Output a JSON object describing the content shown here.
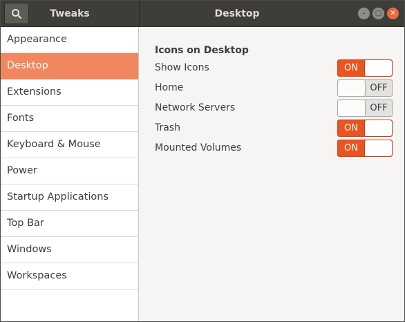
{
  "titlebar": {
    "search_icon": "search-icon",
    "app_title": "Tweaks",
    "page_title": "Desktop",
    "controls": {
      "minimize_glyph": "–",
      "maximize_glyph": "□",
      "close_glyph": "✕"
    }
  },
  "sidebar": {
    "items": [
      {
        "label": "Appearance",
        "active": false
      },
      {
        "label": "Desktop",
        "active": true
      },
      {
        "label": "Extensions",
        "active": false
      },
      {
        "label": "Fonts",
        "active": false
      },
      {
        "label": "Keyboard & Mouse",
        "active": false
      },
      {
        "label": "Power",
        "active": false
      },
      {
        "label": "Startup Applications",
        "active": false
      },
      {
        "label": "Top Bar",
        "active": false
      },
      {
        "label": "Windows",
        "active": false
      },
      {
        "label": "Workspaces",
        "active": false
      }
    ]
  },
  "main": {
    "section_title": "Icons on Desktop",
    "settings": [
      {
        "label": "Show Icons",
        "state": "ON"
      },
      {
        "label": "Home",
        "state": "OFF"
      },
      {
        "label": "Network Servers",
        "state": "OFF"
      },
      {
        "label": "Trash",
        "state": "ON"
      },
      {
        "label": "Mounted Volumes",
        "state": "ON"
      }
    ]
  },
  "colors": {
    "accent": "#e95420",
    "active_sidebar": "#f0875f",
    "titlebar": "#3e3d39"
  }
}
